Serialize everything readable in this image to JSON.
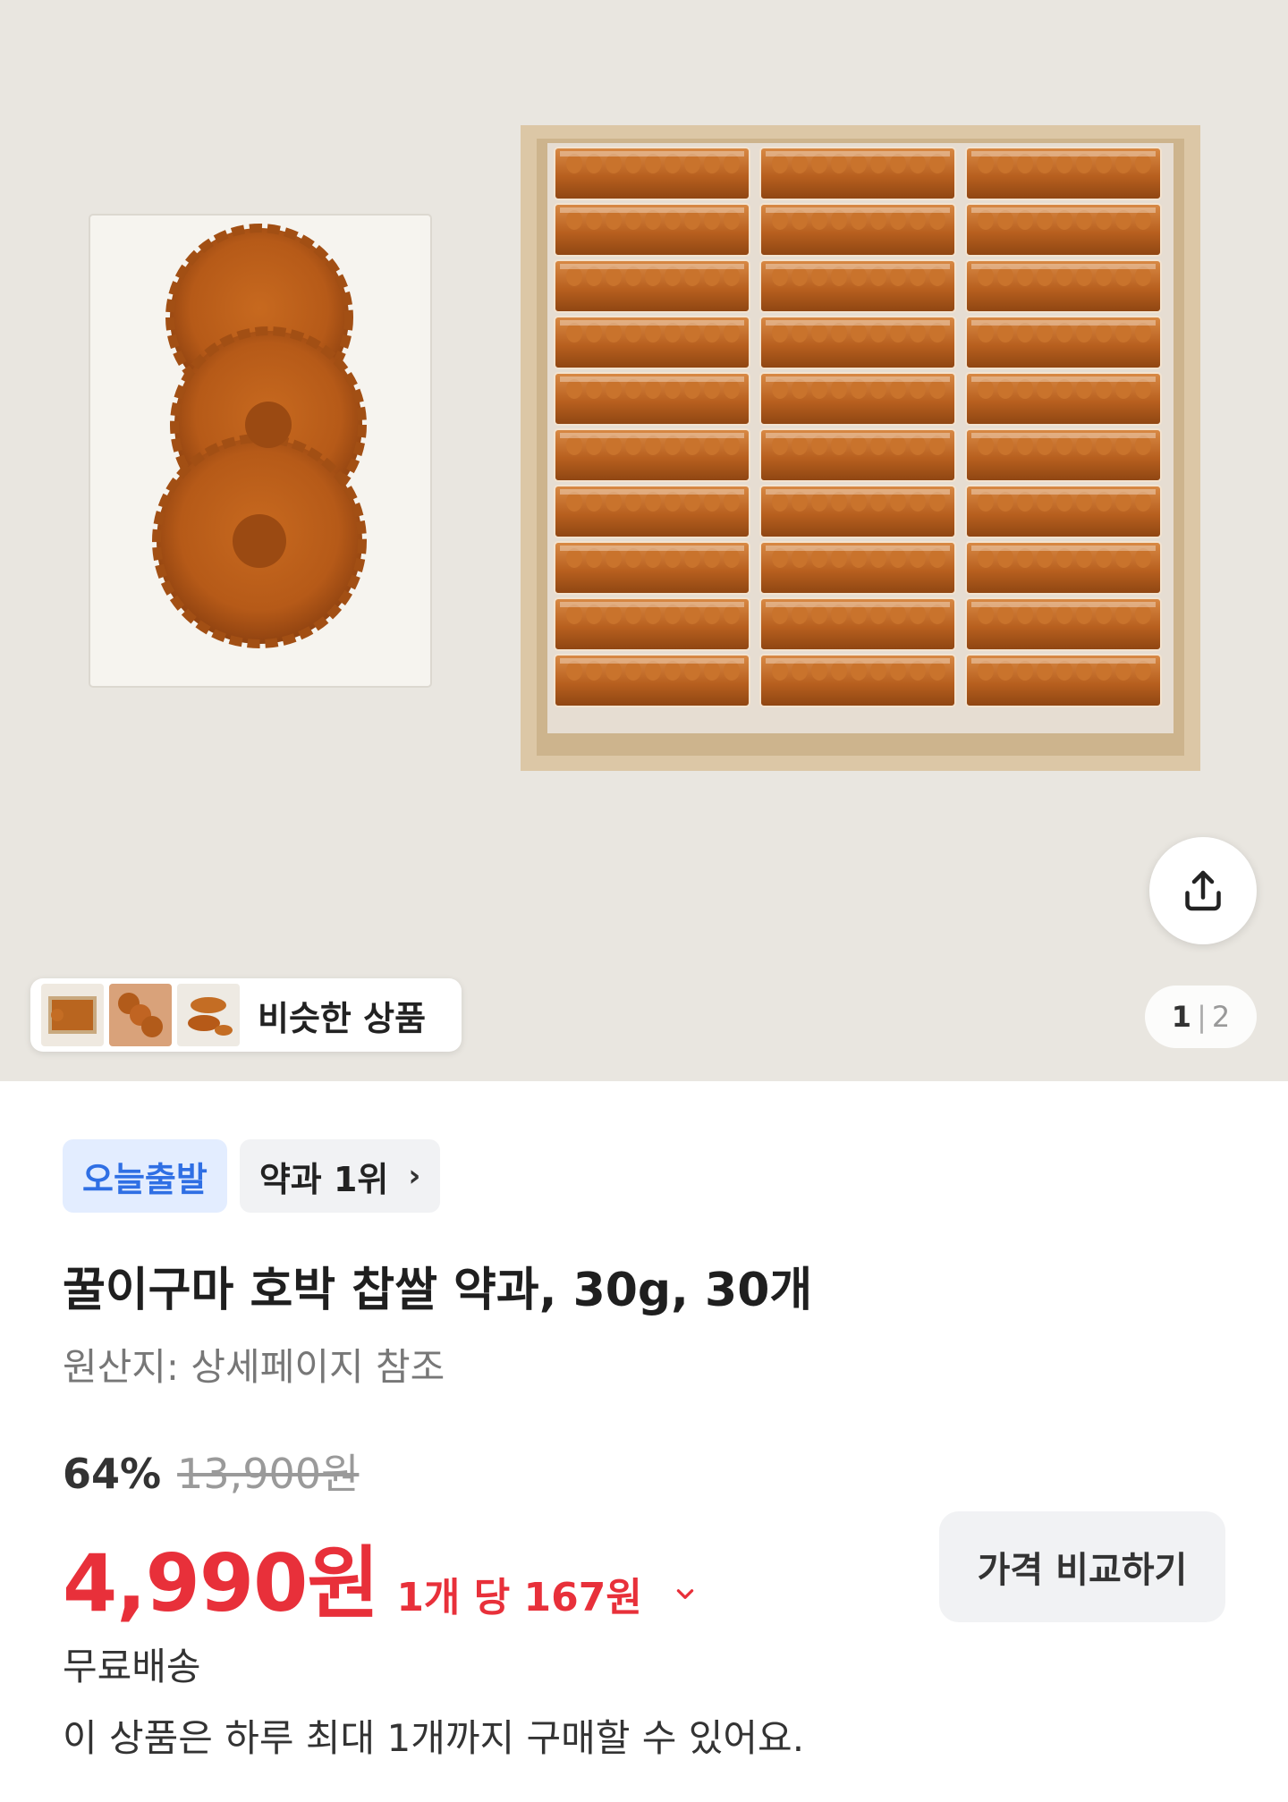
{
  "gallery": {
    "page_current": "1",
    "page_separator": "|",
    "page_total": "2",
    "similar_label": "비슷한 상품",
    "share_icon": "share-icon"
  },
  "badges": {
    "departure": "오늘출발",
    "ranking": "약과 1위",
    "ranking_chevron": "›"
  },
  "product": {
    "title": "꿀이구마 호박 찹쌀 약과, 30g, 30개",
    "origin": "원산지: 상세페이지 참조"
  },
  "price": {
    "discount_rate": "64%",
    "original": "13,900원",
    "sale": "4,990원",
    "unit": "1개 당 167원",
    "compare_button": "가격 비교하기"
  },
  "delivery": {
    "shipping": "무료배송",
    "purchase_limit": "이 상품은 하루 최대 1개까지 구매할 수 있어요."
  },
  "colors": {
    "accent_red": "#e8303a",
    "badge_blue": "#2f6fe4",
    "badge_blue_bg": "#e3edff"
  }
}
